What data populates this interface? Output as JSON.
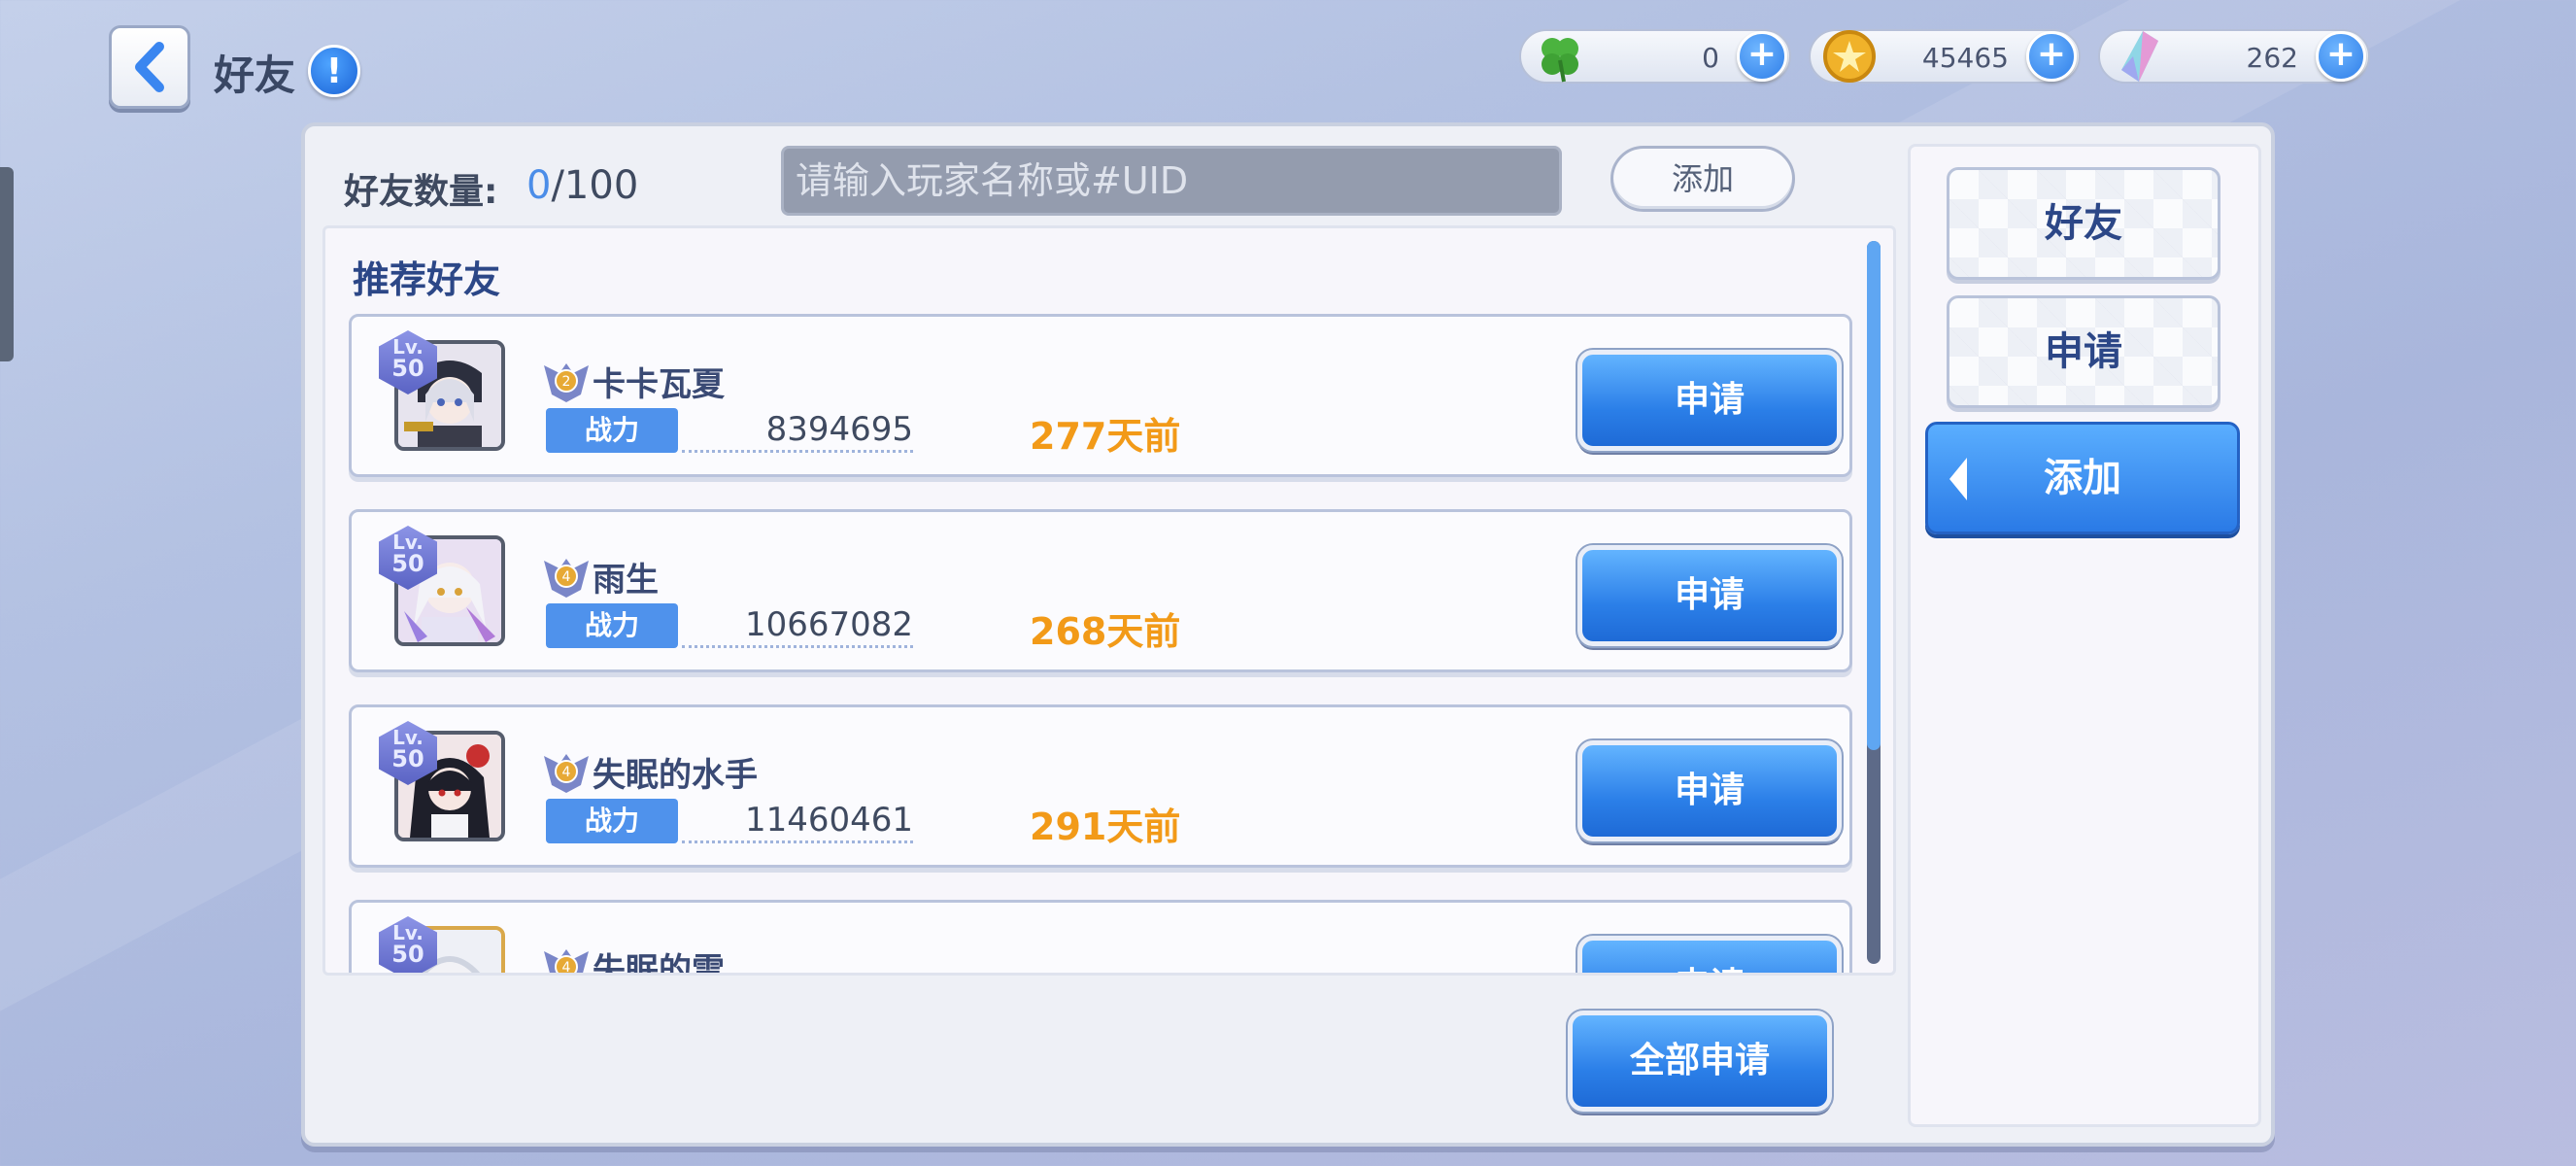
{
  "header": {
    "title": "好友",
    "info_icon": "exclamation-info-icon"
  },
  "currencies": [
    {
      "name": "clover",
      "icon": "clover-icon",
      "value": "0"
    },
    {
      "name": "coin",
      "icon": "gold-coin-icon",
      "value": "45465"
    },
    {
      "name": "crystal",
      "icon": "crystal-icon",
      "value": "262"
    }
  ],
  "friends_panel": {
    "count_label": "好友数量:",
    "count_current": "0",
    "count_max": "/100",
    "search_placeholder": "请输入玩家名称或#UID",
    "search_value": "",
    "add_button": "添加",
    "section_title": "推荐好友",
    "power_label": "战力",
    "apply_label": "申请",
    "apply_all": "全部申请"
  },
  "players": [
    {
      "level_prefix": "Lv.",
      "level": "50",
      "rank": "2",
      "name": "卡卡瓦夏",
      "power": "8394695",
      "last_online": "277天前"
    },
    {
      "level_prefix": "Lv.",
      "level": "50",
      "rank": "4",
      "name": "雨生",
      "power": "10667082",
      "last_online": "268天前"
    },
    {
      "level_prefix": "Lv.",
      "level": "50",
      "rank": "4",
      "name": "失眠的水手",
      "power": "11460461",
      "last_online": "291天前"
    },
    {
      "level_prefix": "Lv.",
      "level": "50",
      "rank": "4",
      "name": "失眠的雪",
      "power": "",
      "last_online": ""
    }
  ],
  "side_tabs": {
    "friends": "好友",
    "requests": "申请",
    "add": "添加"
  },
  "colors": {
    "accent_blue": "#2b7fe8",
    "time_orange": "#f29a18",
    "title_navy": "#2c4787"
  }
}
